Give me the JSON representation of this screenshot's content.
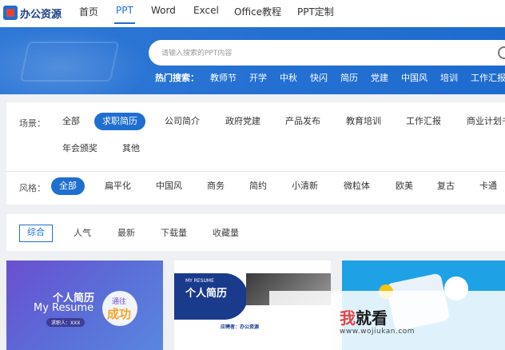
{
  "brand": {
    "name": "办公资源"
  },
  "nav": [
    "首页",
    "PPT",
    "Word",
    "Excel",
    "Office教程",
    "PPT定制"
  ],
  "search": {
    "placeholder": "请输入搜索的PPT内容"
  },
  "hot": {
    "label": "热门搜索：",
    "keywords": [
      "教师节",
      "开学",
      "中秋",
      "快闪",
      "简历",
      "党建",
      "中国风",
      "培训",
      "工作汇报"
    ]
  },
  "scene": {
    "label": "场景：",
    "items": [
      "全部",
      "求职简历",
      "公司简介",
      "政府党建",
      "产品发布",
      "教育培训",
      "工作汇报",
      "商业计划书",
      "年会颁奖",
      "其他"
    ]
  },
  "style": {
    "label": "风格：",
    "items": [
      "全部",
      "扁平化",
      "中国风",
      "商务",
      "简约",
      "小清新",
      "微粒体",
      "欧美",
      "复古",
      "卡通"
    ]
  },
  "sort": [
    "综合",
    "人气",
    "最新",
    "下载量",
    "收藏量"
  ],
  "cards": [
    {
      "title": "个人简历",
      "subtitle": "My Resume",
      "badge1": "通往",
      "badge2": "成功",
      "tag": "求职人：XXX"
    },
    {
      "kicker": "MY RESUME",
      "title": "个人简历",
      "footer": "应聘者：办公资源"
    },
    {}
  ],
  "watermark": {
    "first": "我",
    "rest": "就看",
    "url": "www.wojiukan.com"
  },
  "colors": {
    "accent": "#1f6fd1",
    "banner": "#2470d2"
  }
}
